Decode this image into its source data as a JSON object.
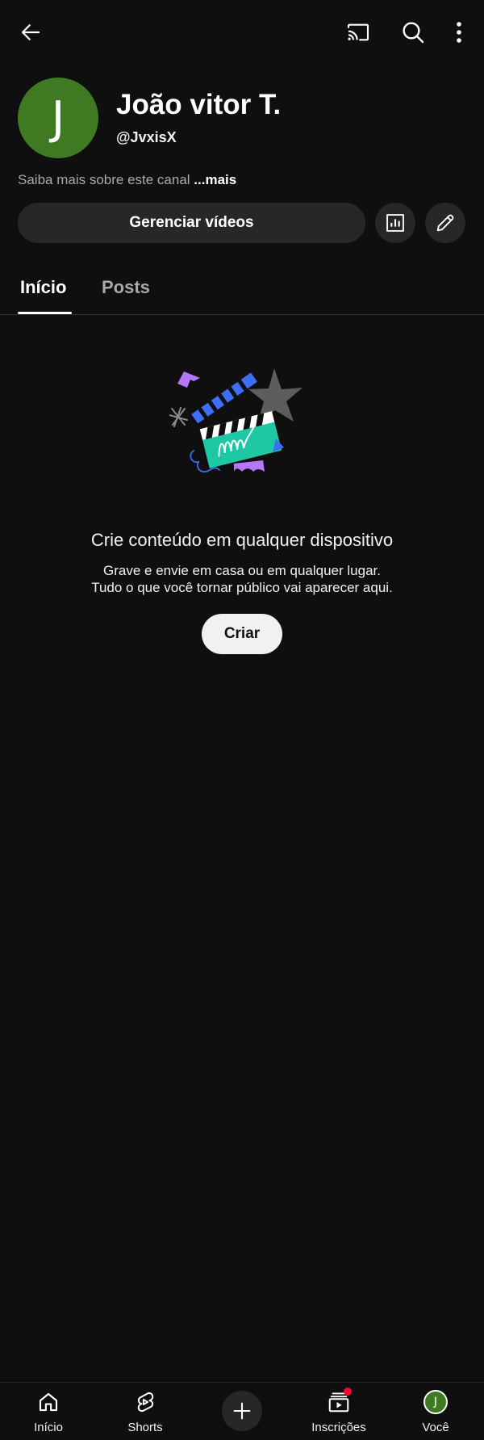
{
  "header": {
    "back_icon": "arrow-left-icon",
    "cast_icon": "cast-icon",
    "search_icon": "search-icon",
    "more_icon": "more-vertical-icon"
  },
  "channel": {
    "avatar_letter": "J",
    "avatar_color": "#3f7a22",
    "name": "João vitor T.",
    "handle": "@JvxisX",
    "about_text": "Saiba mais sobre este canal ",
    "about_more": "...mais",
    "manage_button": "Gerenciar vídeos",
    "analytics_icon": "analytics-icon",
    "edit_icon": "pencil-icon"
  },
  "tabs": [
    {
      "label": "Início",
      "active": true
    },
    {
      "label": "Posts",
      "active": false
    }
  ],
  "empty_state": {
    "illustration": "clapperboard-illustration",
    "title": "Crie conteúdo em qualquer dispositivo",
    "line1": "Grave e envie em casa ou em qualquer lugar.",
    "line2": "Tudo o que você tornar público vai aparecer aqui.",
    "create_button": "Criar"
  },
  "bottom_nav": [
    {
      "label": "Início",
      "icon": "home-icon"
    },
    {
      "label": "Shorts",
      "icon": "shorts-icon"
    },
    {
      "label": "",
      "icon": "plus-icon"
    },
    {
      "label": "Inscrições",
      "icon": "subscriptions-icon",
      "badge": true
    },
    {
      "label": "Você",
      "icon": "avatar",
      "avatar_letter": "J"
    }
  ],
  "colors": {
    "background": "#0f0f0f",
    "surface": "#272727",
    "accent_red": "#ff0033",
    "teal": "#1ec8a5",
    "purple": "#b478ff",
    "blue": "#3d6ef5"
  }
}
